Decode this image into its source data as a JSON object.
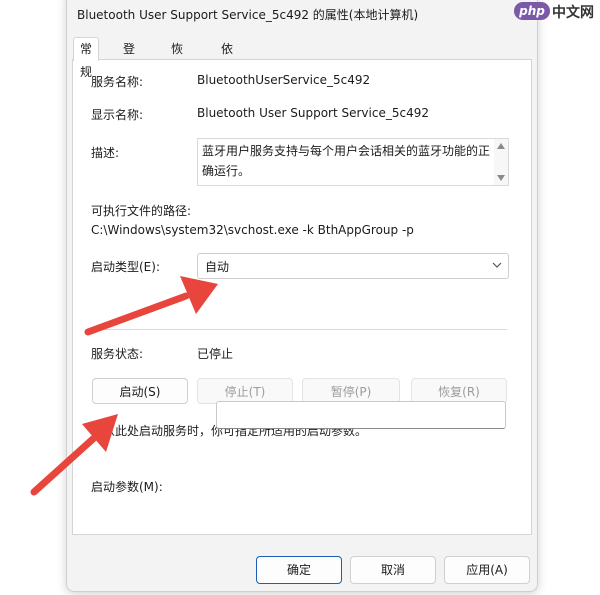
{
  "window": {
    "title": "Bluetooth User Support Service_5c492 的属性(本地计算机)"
  },
  "tabs": [
    {
      "label": "常规",
      "active": true
    },
    {
      "label": "登录",
      "active": false
    },
    {
      "label": "恢复",
      "active": false
    },
    {
      "label": "依存关系",
      "active": false
    }
  ],
  "general": {
    "service_name_label": "服务名称:",
    "service_name_value": "BluetoothUserService_5c492",
    "display_name_label": "显示名称:",
    "display_name_value": "Bluetooth User Support Service_5c492",
    "description_label": "描述:",
    "description_value": "蓝牙用户服务支持与每个用户会话相关的蓝牙功能的正确运行。",
    "exe_path_label": "可执行文件的路径:",
    "exe_path_value": "C:\\Windows\\system32\\svchost.exe -k BthAppGroup -p",
    "startup_type_label": "启动类型(E):",
    "startup_type_value": "自动",
    "service_status_label": "服务状态:",
    "service_status_value": "已停止",
    "hint_text": "当从此处启动服务时，你可指定所适用的启动参数。",
    "start_params_label": "启动参数(M):",
    "start_params_value": ""
  },
  "service_buttons": {
    "start": "启动(S)",
    "stop": "停止(T)",
    "pause": "暂停(P)",
    "resume": "恢复(R)"
  },
  "footer": {
    "ok": "确定",
    "cancel": "取消",
    "apply": "应用(A)"
  },
  "watermark": {
    "logo": "php",
    "text": "中文网"
  },
  "colors": {
    "arrow": "#e8453c",
    "primary_border": "#1b5fb8",
    "logo_bg": "#7a5aa8"
  }
}
